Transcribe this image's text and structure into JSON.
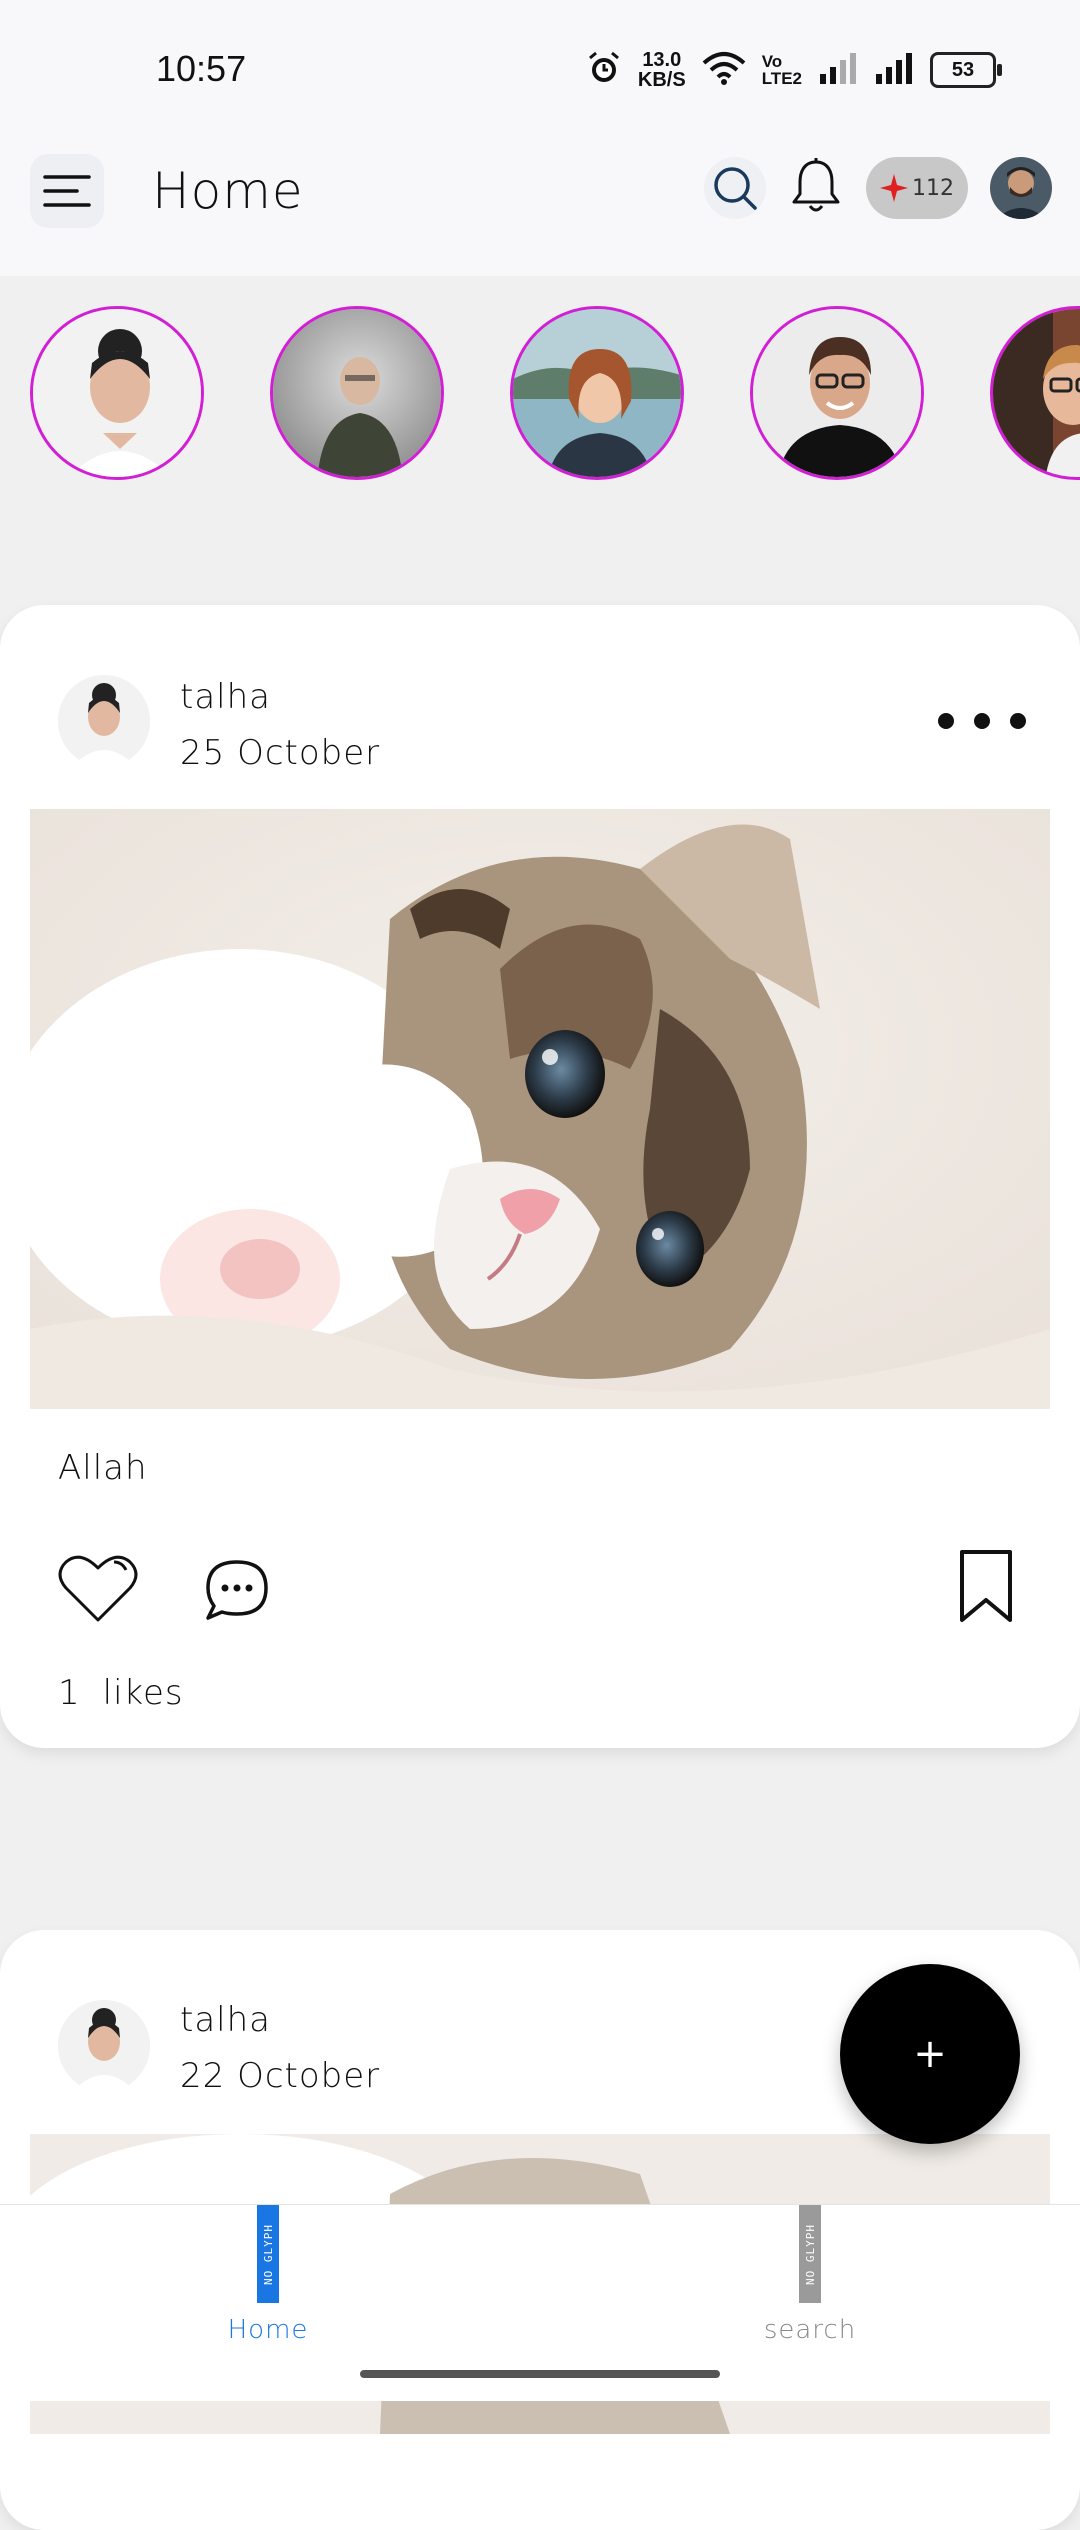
{
  "status_bar": {
    "time": "10:57",
    "net_speed_value": "13.0",
    "net_speed_unit": "KB/S",
    "volte_top": "Vo",
    "volte_bottom": "LTE2",
    "battery": "53",
    "icons": [
      "alarm-icon",
      "wifi-icon",
      "signal-icon",
      "signal-icon",
      "battery-icon"
    ]
  },
  "app_bar": {
    "title": "Home",
    "points": "112",
    "icons": [
      "menu-icon",
      "search-icon",
      "bell-icon",
      "sparkle-icon",
      "avatar"
    ]
  },
  "stories": [
    {
      "name": "story-1"
    },
    {
      "name": "story-2"
    },
    {
      "name": "story-3"
    },
    {
      "name": "story-4"
    },
    {
      "name": "story-5"
    }
  ],
  "posts": [
    {
      "username": "talha",
      "date": "25 October",
      "caption": "Allah",
      "likes_count": "1",
      "likes_label": "likes"
    },
    {
      "username": "talha",
      "date": "22 October"
    }
  ],
  "fab": {
    "label": "+"
  },
  "bottom_nav": {
    "items": [
      {
        "label": "Home",
        "glyph": "NO GLYPH",
        "active": true
      },
      {
        "label": "search",
        "glyph": "NO GLYPH",
        "active": false
      }
    ]
  },
  "colors": {
    "story_ring": "#d21fd6",
    "nav_active": "#1976e3",
    "points_star": "#e02020"
  }
}
